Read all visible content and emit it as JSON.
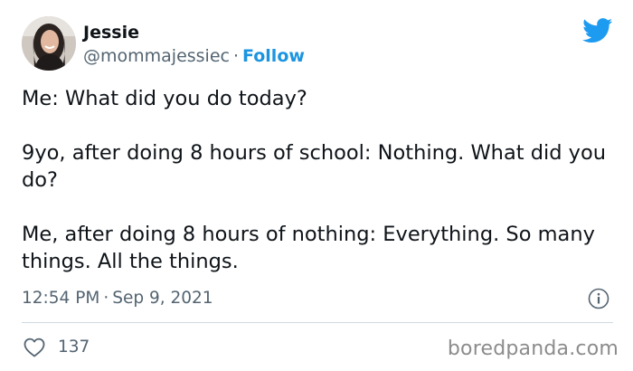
{
  "author": {
    "name": "Jessie",
    "handle": "@mommajessiec",
    "separator": "·",
    "follow_label": "Follow",
    "avatar_icon": "profile-photo"
  },
  "brand": {
    "icon": "twitter-bird-icon",
    "color": "#1d9bf0"
  },
  "tweet": {
    "paragraphs": [
      "Me: What did you do today?",
      "9yo, after doing 8 hours of school: Nothing. What did you do?",
      "Me, after doing 8 hours of nothing: Everything. So many things. All the things."
    ],
    "time": "12:54 PM",
    "date_separator": "·",
    "date": "Sep 9, 2021"
  },
  "actions": {
    "like_icon": "heart-icon",
    "like_count": "137",
    "info_icon": "info-icon"
  },
  "watermark": {
    "text": "boredpanda.com"
  },
  "colors": {
    "text": "#0f1419",
    "secondary": "#536471",
    "link": "#1b95e0",
    "divider": "#cfd9de"
  }
}
